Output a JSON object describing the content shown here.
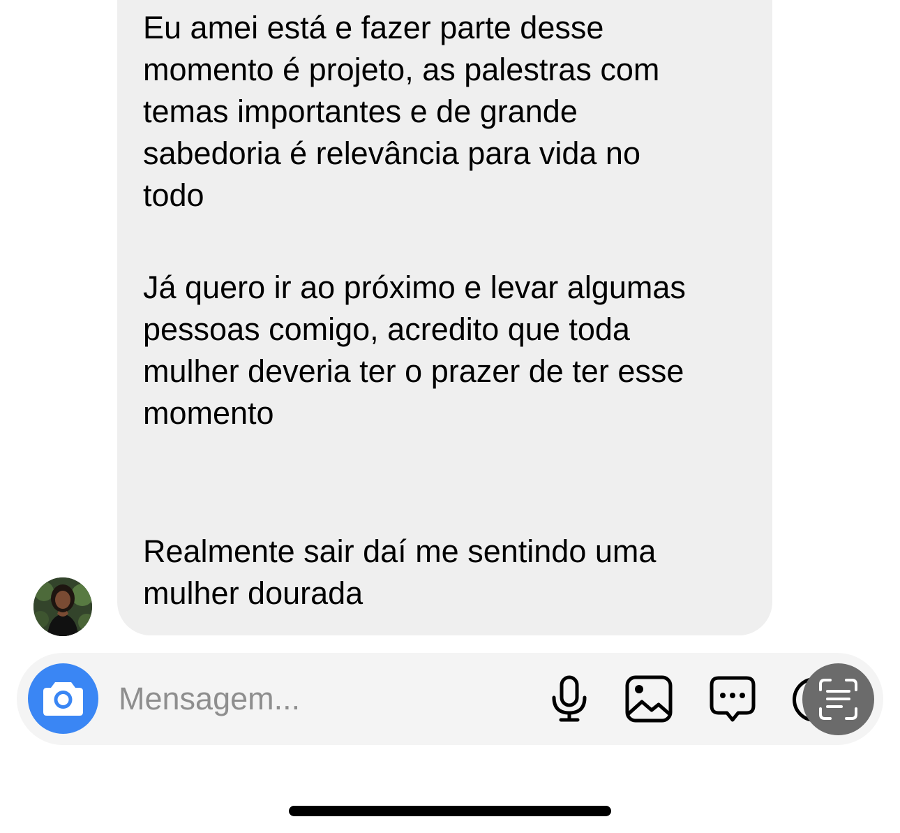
{
  "conversation": {
    "message": {
      "lines": [
        "Eu amei está e fazer parte desse",
        "momento é projeto, as palestras com",
        "temas importantes e de grande",
        "sabedoria é relevância para vida no",
        "todo",
        "Já quero ir ao próximo e levar algumas",
        "pessoas comigo, acredito que toda",
        "mulher deveria ter o prazer de ter esse",
        "momento",
        "Realmente sair daí me sentindo uma",
        "mulher dourada"
      ]
    }
  },
  "composer": {
    "placeholder": "Mensagem...",
    "icons": {
      "camera": "camera-icon",
      "mic": "microphone-icon",
      "gallery": "image-icon",
      "chat": "chat-bubble-icon",
      "scan": "text-scan-icon"
    }
  },
  "colors": {
    "bubble": "#efefef",
    "composer": "#f4f4f4",
    "camera_button": "#3a86f4",
    "scan_button": "#6b6b6b",
    "placeholder_text": "#8e8e8e"
  }
}
